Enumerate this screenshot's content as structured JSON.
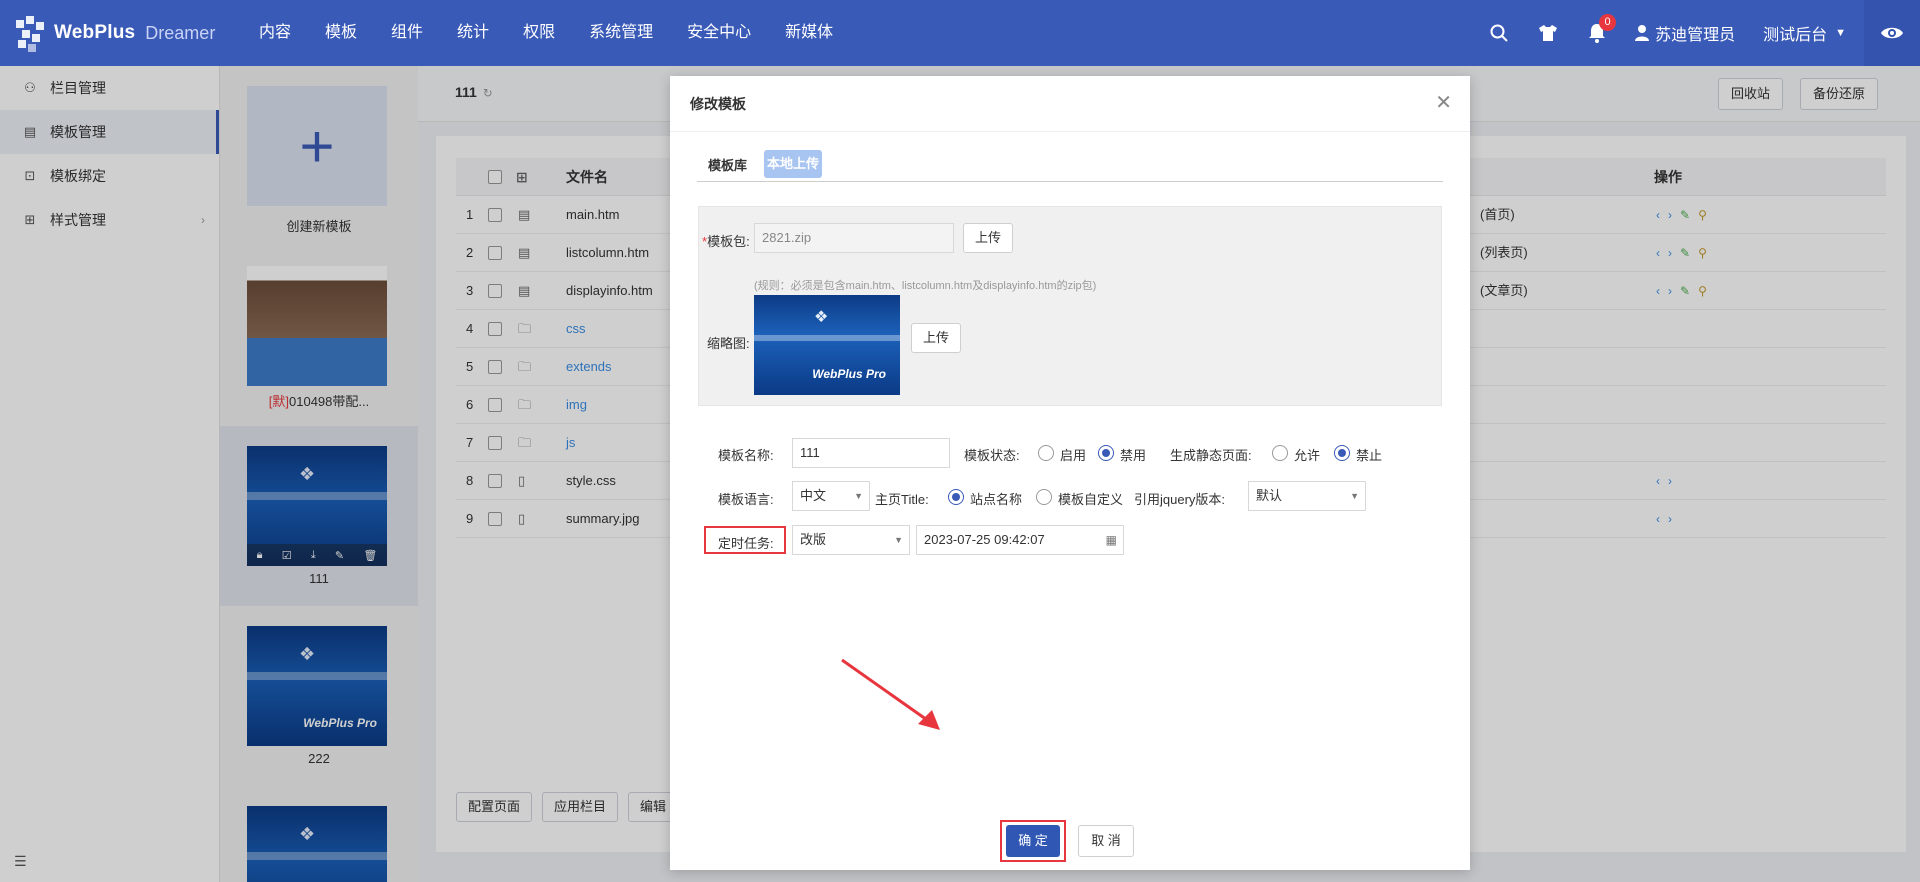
{
  "app": {
    "logo_title": "WebPlus",
    "logo_sub": "Dreamer"
  },
  "topnav": [
    "内容",
    "模板",
    "组件",
    "统计",
    "权限",
    "系统管理",
    "安全中心",
    "新媒体"
  ],
  "topright": {
    "notif_count": "0",
    "user": "苏迪管理员",
    "site": "测试后台"
  },
  "sidebar": {
    "items": [
      {
        "label": "栏目管理"
      },
      {
        "label": "模板管理"
      },
      {
        "label": "模板绑定"
      },
      {
        "label": "样式管理"
      }
    ]
  },
  "templates": {
    "create_label": "创建新模板",
    "items": [
      {
        "label_prefix": "[默]",
        "label": "010498带配..."
      },
      {
        "label": "111"
      },
      {
        "label": "222"
      }
    ],
    "logo_text": "WebPlus Pro"
  },
  "main": {
    "breadcrumb": "111",
    "recycle_btn": "回收站",
    "backup_btn": "备份还原"
  },
  "table": {
    "headers": {
      "filename": "文件名",
      "ops": "操作"
    },
    "rows": [
      {
        "idx": "1",
        "name": "main.htm",
        "note": "(首页)"
      },
      {
        "idx": "2",
        "name": "listcolumn.htm",
        "note": "(列表页)"
      },
      {
        "idx": "3",
        "name": "displayinfo.htm",
        "note": "(文章页)"
      },
      {
        "idx": "4",
        "name": "css",
        "note": ""
      },
      {
        "idx": "5",
        "name": "extends",
        "note": ""
      },
      {
        "idx": "6",
        "name": "img",
        "note": ""
      },
      {
        "idx": "7",
        "name": "js",
        "note": ""
      },
      {
        "idx": "8",
        "name": "style.css",
        "note": ""
      },
      {
        "idx": "9",
        "name": "summary.jpg",
        "note": ""
      }
    ],
    "footer_buttons": [
      "配置页面",
      "应用栏目",
      "编辑"
    ]
  },
  "modal": {
    "title": "修改模板",
    "tabs": [
      "模板库",
      "本地上传"
    ],
    "package_label": "模板包:",
    "package_value": "2821.zip",
    "upload_label": "上传",
    "rule": "(规则：必须是包含main.htm、listcolumn.htm及displayinfo.htm的zip包)",
    "thumb_label": "缩略图:",
    "name_label": "模板名称:",
    "name_value": "111",
    "status_label": "模板状态:",
    "status_on": "启用",
    "status_off": "禁用",
    "static_label": "生成静态页面:",
    "static_allow": "允许",
    "static_deny": "禁止",
    "lang_label": "模板语言:",
    "lang_value": "中文",
    "home_title_label": "主页Title:",
    "home_title_site": "站点名称",
    "home_title_custom": "模板自定义",
    "jquery_label": "引用jquery版本:",
    "jquery_value": "默认",
    "task_label": "定时任务:",
    "task_value": "改版",
    "task_time": "2023-07-25 09:42:07",
    "confirm": "确 定",
    "cancel": "取 消",
    "accent": "#2f57b3",
    "highlight": "#e7363d"
  }
}
